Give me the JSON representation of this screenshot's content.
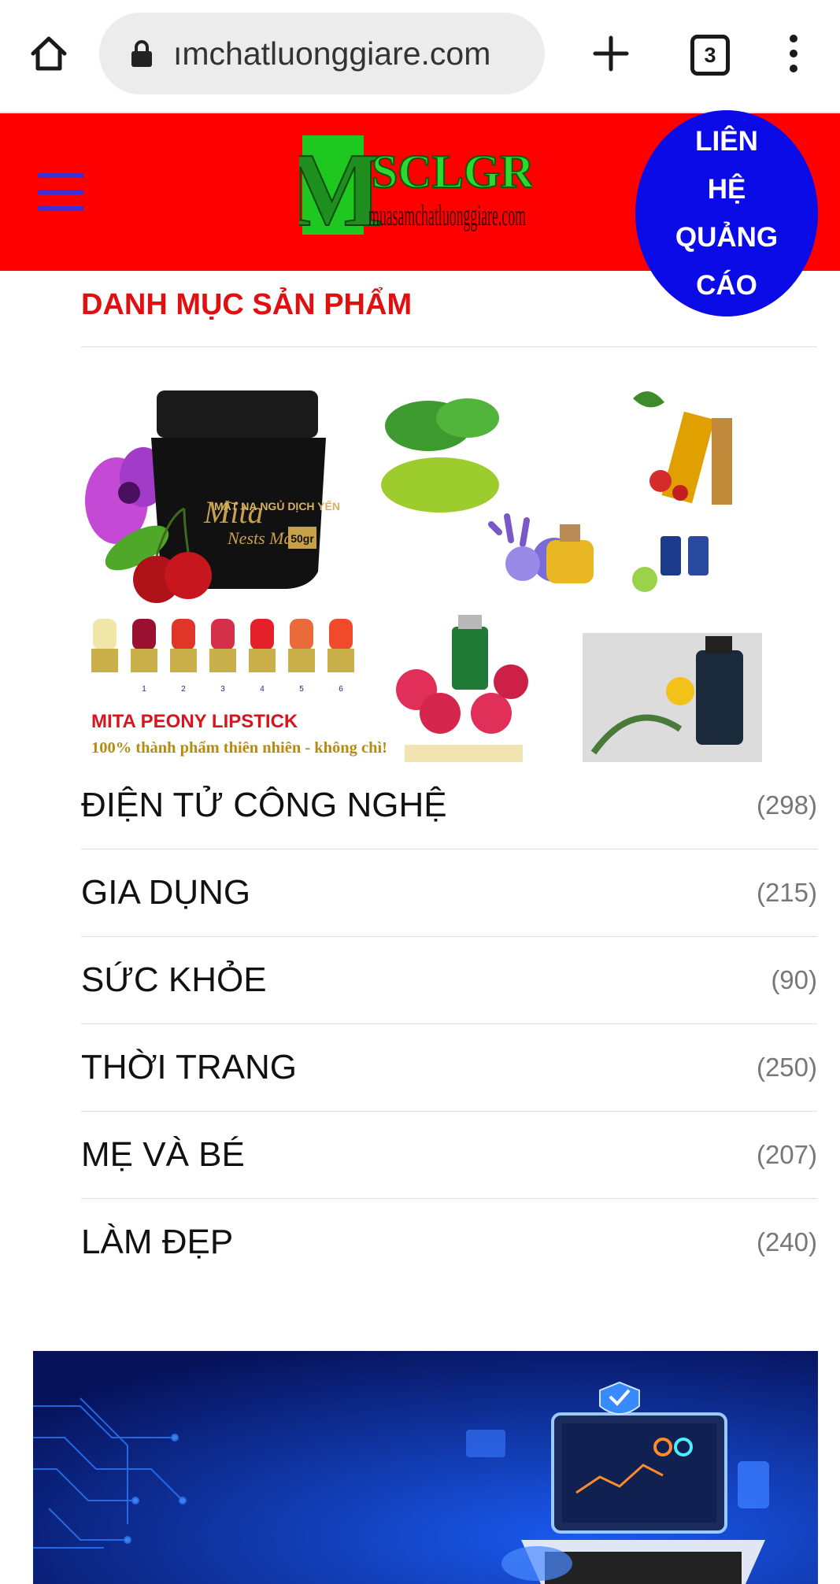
{
  "browser": {
    "url": "ımchatluonggiare.com",
    "tab_count": "3"
  },
  "header": {
    "logo_big": "SCLGR",
    "logo_letter": "M",
    "logo_small": "muasamchatluonggiare.com",
    "contact_lines": [
      "LIÊN",
      "HỆ",
      "QUẢNG",
      "CÁO"
    ],
    "bg_color": "#ff0000",
    "contact_color": "#0b0be8"
  },
  "categories": {
    "title": "DANH MỤC SẢN PHẨM",
    "banner": {
      "jar_label": "MẶT NẠ NGỦ DỊCH YẾN",
      "jar_brand": "Mita",
      "jar_sub": "Nests Mask",
      "jar_weight": "50gr",
      "lipstick_title": "MITA PEONY LIPSTICK",
      "lipstick_sub": "100% thành phẩm thiên nhiên - không chì!",
      "shade_numbers": [
        "1",
        "2",
        "3",
        "4",
        "5",
        "6"
      ]
    },
    "items": [
      {
        "name": "ĐIỆN TỬ CÔNG NGHỆ",
        "count": "(298)"
      },
      {
        "name": "GIA DỤNG",
        "count": "(215)"
      },
      {
        "name": "SỨC KHỎE",
        "count": "(90)"
      },
      {
        "name": "THỜI TRANG",
        "count": "(250)"
      },
      {
        "name": "MẸ VÀ BÉ",
        "count": "(207)"
      },
      {
        "name": "LÀM ĐẸP",
        "count": "(240)"
      }
    ]
  }
}
